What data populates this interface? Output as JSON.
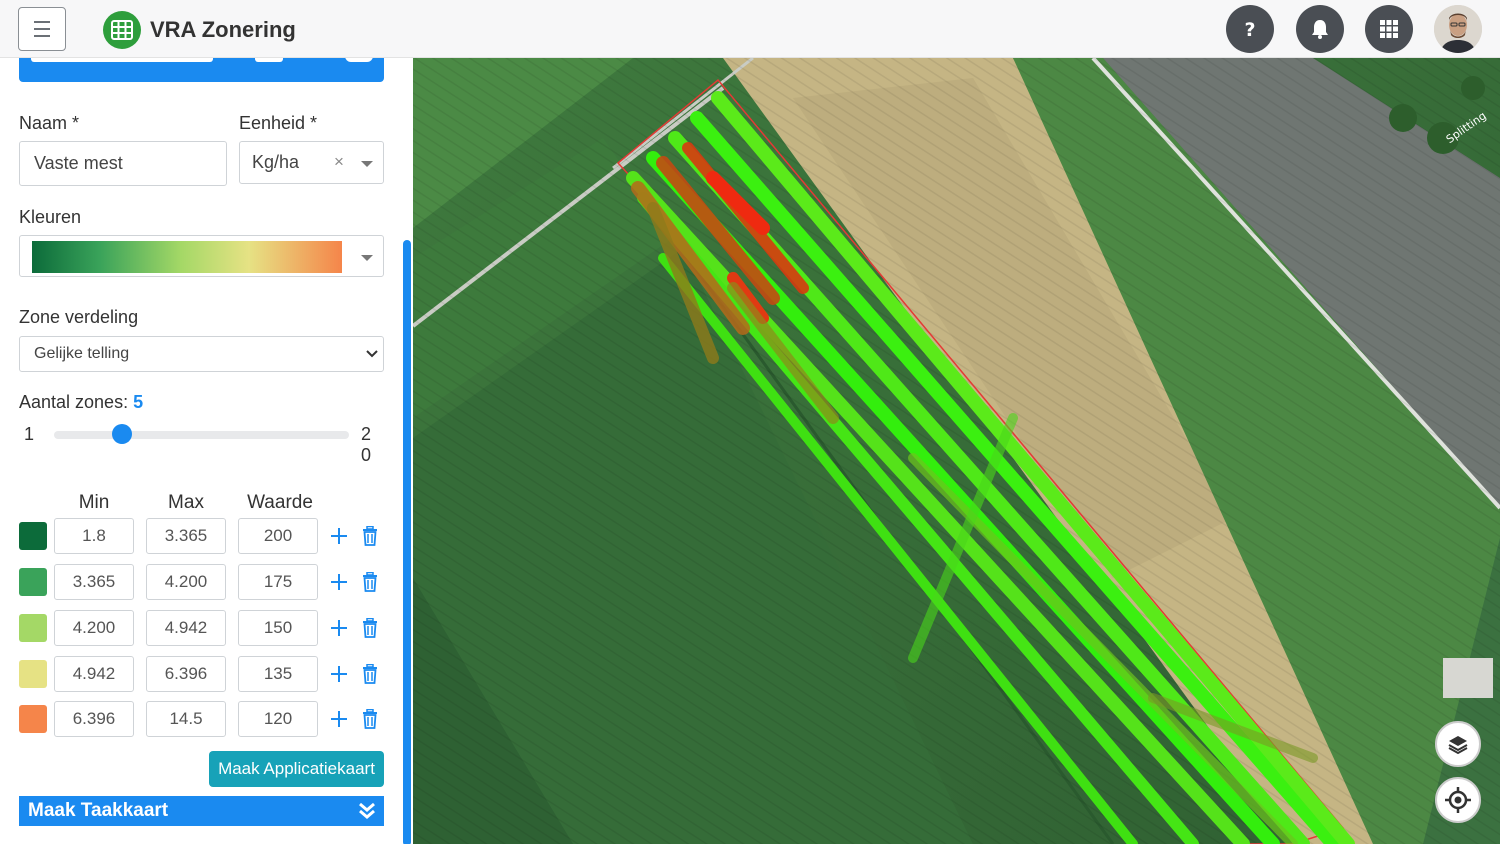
{
  "app": {
    "title": "VRA Zonering"
  },
  "form": {
    "naam_label": "Naam *",
    "naam_value": "Vaste mest",
    "eenheid_label": "Eenheid *",
    "eenheid_value": "Kg/ha",
    "eenheid_clear": "×",
    "kleuren_label": "Kleuren",
    "zone_verdeling_label": "Zone verdeling",
    "zone_verdeling_value": "Gelijke telling",
    "aantal_zones_label": "Aantal zones:",
    "aantal_zones_value": "5",
    "slider_min": "1",
    "slider_max_line1": "2",
    "slider_max_line2": "0"
  },
  "zones": {
    "headers": {
      "min": "Min",
      "max": "Max",
      "value": "Waarde"
    },
    "rows": [
      {
        "color": "#0c6b3a",
        "min": "1.8",
        "max": "3.365",
        "value": "200"
      },
      {
        "color": "#3aa35a",
        "min": "3.365",
        "max": "4.200",
        "value": "175"
      },
      {
        "color": "#a4d866",
        "min": "4.200",
        "max": "4.942",
        "value": "150"
      },
      {
        "color": "#e6e284",
        "min": "4.942",
        "max": "6.396",
        "value": "135"
      },
      {
        "color": "#f5854a",
        "min": "6.396",
        "max": "14.5",
        "value": "120"
      }
    ]
  },
  "actions": {
    "make_application_map": "Maak Applicatiekaart",
    "make_task_map": "Maak Taakkaart"
  },
  "colors": {
    "primary": "#1a8af0",
    "teal": "#17a2b8",
    "brand_green": "#2e9e3c"
  }
}
